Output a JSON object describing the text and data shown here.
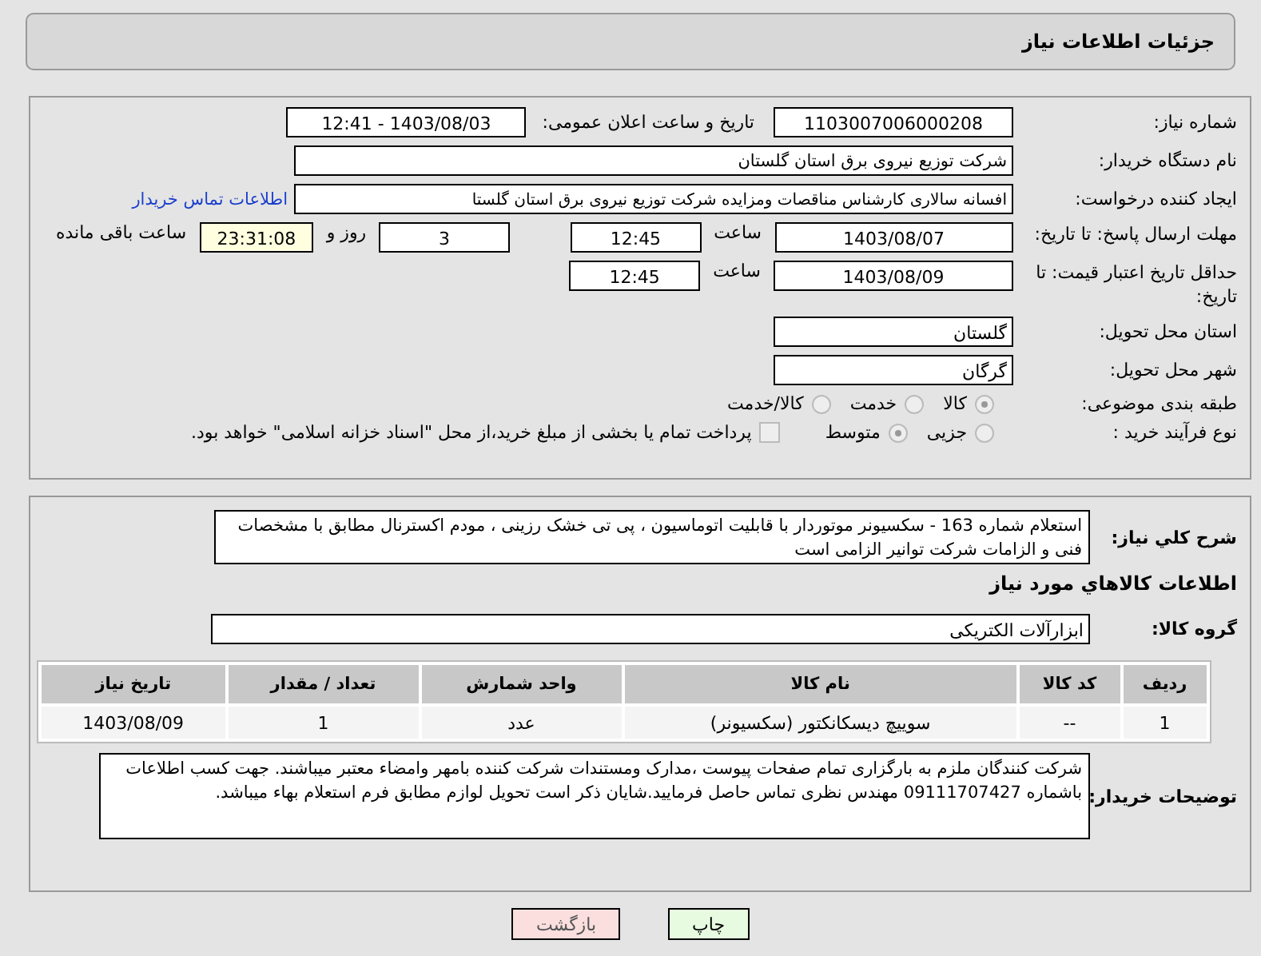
{
  "header": {
    "title": "جزئیات اطلاعات نیاز"
  },
  "need_number": {
    "label": "شماره نیاز:",
    "value": "1103007006000208"
  },
  "announce": {
    "label": "تاریخ و ساعت اعلان عمومی:",
    "value": "1403/08/03 - 12:41"
  },
  "buyer": {
    "label": "نام دستگاه خریدار:",
    "value": "شرکت توزیع نیروی برق استان گلستان"
  },
  "creator": {
    "label": "ایجاد کننده درخواست:",
    "value": "افسانه سالاری کارشناس مناقصات ومزایده شرکت توزیع نیروی برق استان گلستا",
    "link": "اطلاعات تماس خریدار"
  },
  "deadline": {
    "label": "مهلت ارسال پاسخ: تا تاریخ:",
    "date": "1403/08/07",
    "time_label": "ساعت",
    "time": "12:45",
    "days": "3",
    "days_label": "روز و",
    "remaining": "23:31:08",
    "remaining_label": "ساعت باقی مانده"
  },
  "validity": {
    "label": "حداقل تاریخ اعتبار قیمت: تا تاریخ:",
    "date": "1403/08/09",
    "time_label": "ساعت",
    "time": "12:45"
  },
  "province": {
    "label": "استان محل تحویل:",
    "value": "گلستان"
  },
  "city": {
    "label": "شهر محل تحویل:",
    "value": "گرگان"
  },
  "category": {
    "label": "طبقه بندی موضوعی:",
    "options": [
      {
        "label": "کالا",
        "selected": true
      },
      {
        "label": "خدمت",
        "selected": false
      },
      {
        "label": "کالا/خدمت",
        "selected": false
      }
    ]
  },
  "process": {
    "label": "نوع فرآیند خرید :",
    "options": [
      {
        "label": "جزیی",
        "selected": false
      },
      {
        "label": "متوسط",
        "selected": true
      }
    ],
    "treasury": {
      "label": "پرداخت تمام یا بخشی از مبلغ خرید،از محل \"اسناد خزانه اسلامی\" خواهد بود.",
      "checked": false
    }
  },
  "description": {
    "label": "شرح کلي نياز:",
    "value": "استعلام شماره 163 - سکسیونر موتوردار با قابلیت اتوماسیون ، پی تی خشک رزینی ، مودم اکسترنال مطابق با مشخصات فنی و الزامات شرکت توانیر الزامی است"
  },
  "goods_title": "اطلاعات کالاهاي مورد نياز",
  "goods_group": {
    "label": "گروه کالا:",
    "value": "ابزارآلات الکتریکی"
  },
  "table": {
    "columns": [
      "ردیف",
      "کد کالا",
      "نام کالا",
      "واحد شمارش",
      "تعداد / مقدار",
      "تاریخ نیاز"
    ],
    "rows": [
      [
        "1",
        "--",
        "سوییچ دیسکانکتور (سکسیونر)",
        "عدد",
        "1",
        "1403/08/09"
      ]
    ]
  },
  "notes": {
    "label": "توضیحات خریدار:",
    "value": "شرکت کنندگان ملزم به بارگزاری تمام صفحات پیوست ،مدارک ومستندات شرکت کننده بامهر وامضاء معتبر میباشند. جهت کسب اطلاعات باشماره 09111707427 مهندس نظری  تماس حاصل فرمایید.شایان ذکر است تحویل لوازم مطابق فرم استعلام بهاء میباشد."
  },
  "buttons": [
    {
      "label": "چاپ",
      "kind": "print"
    },
    {
      "label": "بازگشت",
      "kind": "back"
    }
  ]
}
